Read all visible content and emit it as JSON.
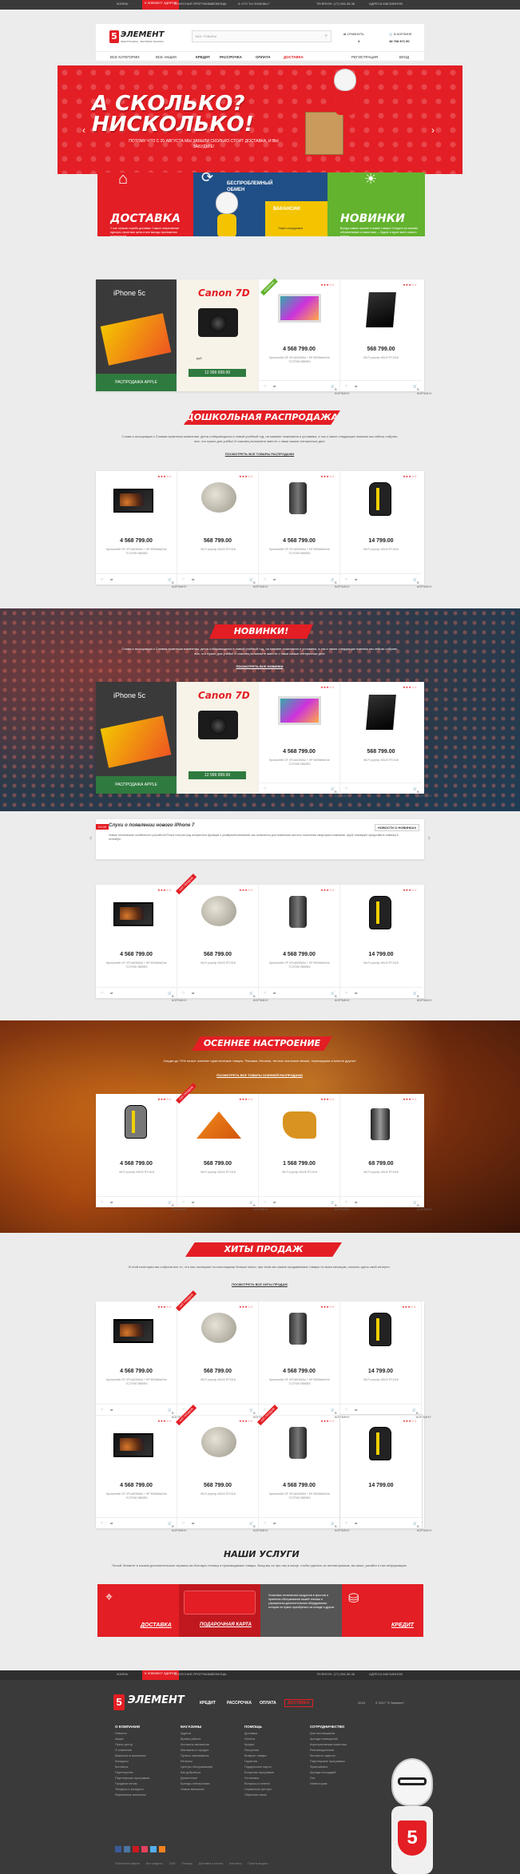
{
  "top_bar": {
    "items": [
      "ЖИЗНЬ",
      "5 ЭЛЕМЕНТ ЗДОРОВ",
      "БОНУСНАЯ ПРОГРАММА",
      "ПОМОЩЬ",
      "А ЧТО ТЫ ЗНАЕШЬ?",
      "ТЕЛЕФОН: (17) 306-38-38",
      "АДРЕСА МАГАЗИНОВ"
    ]
  },
  "header": {
    "logo_mark": "5",
    "logo_text": "ЭЛЕМЕНТ",
    "logo_sub": "ЭЛЕКТРОНИКА · БЫТОВАЯ ТЕХНИКА",
    "search_placeholder": "ВСЕ ТОВАРЫ",
    "compare": "СРАВНИТЬ",
    "compare_count": "4",
    "cart": "В КОРЗИНЕ",
    "cart_sum": "48 768 871.50",
    "login": "РЕГИСТРАЦИЯ",
    "enter": "ВХОД"
  },
  "nav": {
    "items": [
      "ВСЕ КАТЕГОРИИ",
      "ВСЕ АКЦИИ",
      "КРЕДИТ",
      "РАССРОЧКА",
      "ОПЛАТА",
      "ДОСТАВКА"
    ]
  },
  "hero": {
    "title": "А СКОЛЬКО? НИСКОЛЬКО!",
    "subtitle": "ПОТОМУ ЧТО С 20 АВГУСТА МЫ ЗАБЫЛИ СКОЛЬКО СТОИТ ДОСТАВКА, И ВЫ ЗАБУДЬТЕ!"
  },
  "promo_tiles": [
    {
      "title": "ДОСТАВКА",
      "text": "У нас лучшая служба доставки. Самые оперативные курьеры, приятные цены и все выгоды приложения лояльности!"
    },
    {
      "title": "БЕСПРОБЛЕМНЫЙ ОБМЕН",
      "text": "ВАКАНСИИ",
      "extra": "Отдел сотрудников"
    },
    {
      "title": "НОВИНКИ",
      "text": "Всегда самые лучшие и новые товары! Следите за нашими обновлениями и новостями — будьте в курсе всего самого нового."
    }
  ],
  "showcase": {
    "iphone_label": "iPhone 5c",
    "canon_label": "Canon 7D",
    "apple_sale": "РАСПРОДАЖА APPLE",
    "canon_price_tag": "12 999 999.99",
    "old_price_tag": "руб",
    "imac_price": "4 568 799.00",
    "router_price": "568 799.00",
    "imac_desc": "Кронштейн DF VFUA03W4sl + HP 600MetaOne 7C27000 0850BX",
    "router_desc": "Wi-Fi роутер ASUS RT-N18",
    "cart_label": "В КОРЗИНУ"
  },
  "sections": {
    "preschool_title": "ДОШКОЛЬНАЯ РАСПРОДАЖА",
    "preschool_text": "Слова и ассоциации к Словам приятным моментам, деток собирающихся в новый учебный год, на мамине пожелания и условиям, а так и своих следующих новинок мы сейчас собрать все, что нужно для учёбы! И наконец вспомните вместе с нами самые интересные дни!",
    "preschool_link": "ПОСМОТРЕТЬ ВСЕ ТОВАРЫ РАСПРОДАЖИ",
    "new_title": "НОВИНКИ!",
    "new_text": "Слова и ассоциации к Словам приятным моментам, деток собирающихся в новый учебный год, на мамине пожелания и условиям, а так и своих следующих новинок мы сейчас собрать все, что нужно для учёбы! И наконец вспомните вместе с нами самые интересные дни!",
    "new_link": "ПОСМОТРЕТЬ ВСЕ НОВИНКИ",
    "autumn_title": "ОСЕННЕЕ НАСТРОЕНИЕ",
    "autumn_text": "Скидки до 70% на все осенние туристические товары. Рюкзаки, ботинки, теплые спальные мешки, термокружки и многое другое!",
    "autumn_link": "ПОСМОТРЕТЬ ВСЕ ТОВАРЫ ОСЕННЕЙ РАСПРОДАЖИ",
    "hits_title": "ХИТЫ ПРОДАЖ",
    "hits_text": "В этой категории мы собрали все то, что нас посещают по-настоящему больше всего, при этом мы самые продаваемые товары по всем месяцам, сыскать здесь свой интерес.",
    "hits_link": "ПОСМОТРЕТЬ ВСЕ ХИТЫ ПРОДАЖ",
    "services_title": "НАШИ УСЛУГИ",
    "services_text": "Пятый Элемент в нашем дополнительные сервисы на бытовую технику и производимые товары. Вход мы их про нас в конце, чтобы сделать их неповторимым, вы ниже, узнайте о них информацию."
  },
  "news": {
    "date": "01.09",
    "title": "Слухи о появлении нового iPhone 7",
    "all": "НОВОСТИ О НОВИНКАХ",
    "text": "Новые технические особенности устройств iPhone получат ряд интересных функций и усовершенствований, как полагается для появления шестого поколения смартфона компании. Apple планирует представить новинку в сентябре."
  },
  "products_generic": [
    {
      "price": "4 568 799.00",
      "desc": "Кронштейн DF VFUA03W4sl + HP 600MetaOne 7C27000 0850BX"
    },
    {
      "price": "568 799.00",
      "desc": "Wi-Fi роутер ASUS RT-N18"
    },
    {
      "price": "4 568 799.00",
      "desc": "Кронштейн DF VFUA03W4sl + HP 600MetaOne 7C27000 0850BX"
    },
    {
      "price": "14 799.00",
      "desc": "Wi-Fi роутер ASUS RT-N18"
    }
  ],
  "products_autumn": [
    {
      "price": "4 568 799.00",
      "desc": "Wi-Fi роутер ASUS RT-N18"
    },
    {
      "price": "568 799.00",
      "desc": "Wi-Fi роутер ASUS RT-N18"
    },
    {
      "price": "1 568 799.00",
      "desc": "Wi-Fi роутер ASUS RT-N18"
    },
    {
      "price": "68 799.00",
      "desc": "Wi-Fi роутер ASUS RT-N18"
    }
  ],
  "badges": {
    "new": "НОВИНКА",
    "hit": "ХИТ ПРОДАЖ",
    "sale": "СКИДКА"
  },
  "cart_label": "В КОРЗИНУ",
  "stars": "★★★☆☆",
  "services": [
    {
      "title": "ДОСТАВКА"
    },
    {
      "title": "ПОДАРОЧНАЯ КАРТА",
      "text": "Установка технических продуктов в простом и приятном обслуживании вашей техники и упрощенном дополнительном оборудовании, которые не нужно приобретать на складе и другие."
    },
    {
      "title": "КРЕДИТ"
    }
  ],
  "footer": {
    "logo_mark": "5",
    "logo_text": "ЭЛЕМЕНТ",
    "nav": [
      "КРЕДИТ",
      "РАССРОЧКА",
      "ОПЛАТА",
      "ДОСТАВКА"
    ],
    "copyright": "© 2017 \"5 Элемент\"",
    "year": "2015",
    "columns": [
      {
        "title": "О КОМПАНИИ",
        "items": [
          "Новости",
          "Акции",
          "Пресс-центр",
          "О компании",
          "Вакансии в магазинах",
          "Конкурсы",
          "Контакты",
          "Партнерство",
          "Партнерская программа",
          "Продажи оптом",
          "Тендеры и конкурсы",
          "Фирменные магазины"
        ]
      },
      {
        "title": "МАГАЗИНЫ",
        "items": [
          "Адреса",
          "Время работы",
          "Контакты магазинов",
          "Магазины в городах",
          "Пункты самовывоза",
          "Регионы",
          "Центры обслуживания",
          "Как добраться",
          "Дисконтные",
          "Бренды электроники",
          "Новые магазины"
        ]
      },
      {
        "title": "ПОМОЩЬ",
        "items": [
          "Доставка",
          "Оплата",
          "Кредит",
          "Рассрочка",
          "Возврат товара",
          "Гарантия",
          "Подарочные карты",
          "Бонусная программа",
          "Установка",
          "Вопросы и ответы",
          "Сервисные центры",
          "Обратная связь"
        ]
      },
      {
        "title": "СОТРУДНИЧЕСТВО",
        "items": [
          "Для поставщиков",
          "Аренда помещений",
          "Корпоративным клиентам",
          "Рекламодателям",
          "Контакты отделов",
          "Партнерские программы",
          "Франчайзинг",
          "Аренда площадей",
          "Опт",
          "Инвесторам"
        ]
      }
    ],
    "bottom_links": [
      "Публичная оферта",
      "Все разделы",
      "2015",
      "Помощь",
      "Доставка и оплата",
      "Контакты",
      "Пункты выдачи"
    ]
  }
}
